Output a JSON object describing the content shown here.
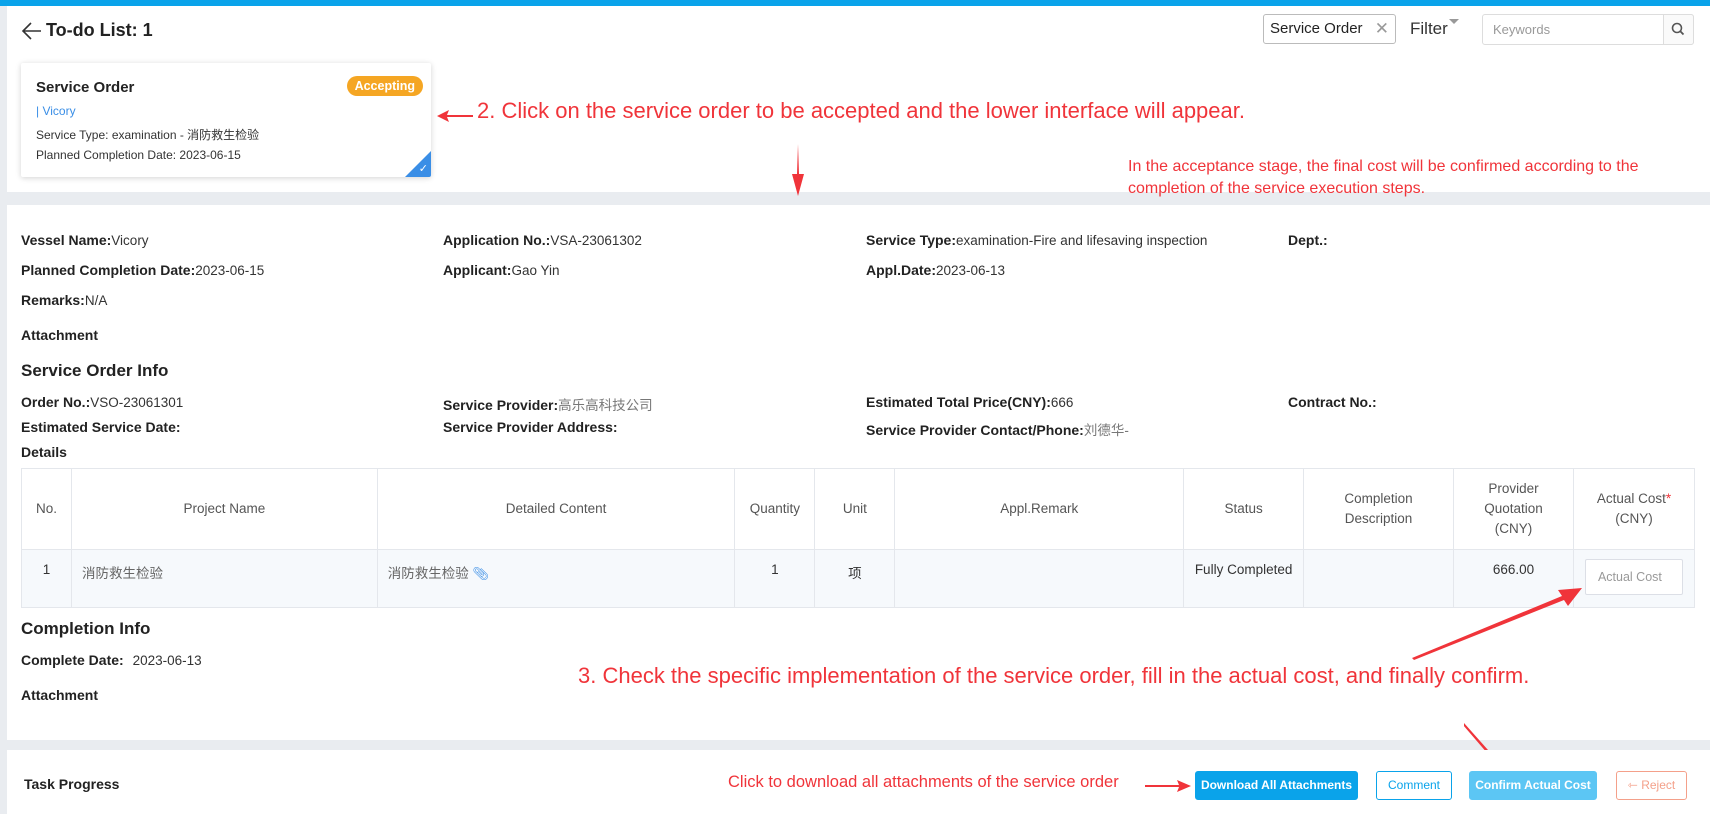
{
  "header": {
    "title": "To-do List: 1",
    "filter_chip": "Service Order",
    "filter_label": "Filter",
    "search_placeholder": "Keywords"
  },
  "card": {
    "title": "Service Order",
    "status_badge": "Accepting",
    "vessel": "| Vicory",
    "service_type": "Service Type:  examination - 消防救生检验",
    "planned_date": "Planned Completion Date:  2023-06-15"
  },
  "annotations": {
    "step2": "2. Click on the service order to be accepted and the lower interface will appear.",
    "cost_note": "In the acceptance stage, the final cost will be confirmed according to the completion of the service execution steps.",
    "step3": "3. Check the specific implementation of the service order, fill in the actual cost, and finally confirm.",
    "download_note": "Click to download all attachments of the service order"
  },
  "application": {
    "vessel_name_label": "Vessel Name:",
    "vessel_name": "Vicory",
    "application_no_label": "Application No.:",
    "application_no": "VSA-23061302",
    "service_type_label": "Service Type:",
    "service_type": "examination-Fire and lifesaving inspection",
    "dept_label": "Dept.:",
    "dept": "",
    "planned_date_label": "Planned Completion Date:",
    "planned_date": "2023-06-15",
    "applicant_label": "Applicant:",
    "applicant": "Gao Yin",
    "appl_date_label": "Appl.Date:",
    "appl_date": "2023-06-13",
    "remarks_label": "Remarks:",
    "remarks": "N/A",
    "attachment_label": "Attachment"
  },
  "service_order_info": {
    "title": "Service Order Info",
    "order_no_label": "Order No.:",
    "order_no": "VSO-23061301",
    "provider_label": "Service Provider:",
    "provider": "高乐高科技公司",
    "est_price_label": "Estimated Total Price(CNY):",
    "est_price": "666",
    "contract_no_label": "Contract No.:",
    "contract_no": "",
    "est_date_label": "Estimated Service Date:",
    "est_date": "",
    "provider_address_label": "Service Provider Address:",
    "provider_address": "",
    "contact_label": "Service Provider Contact/Phone:",
    "contact": "刘德华-",
    "details_label": "Details"
  },
  "details_table": {
    "columns": [
      "No.",
      "Project Name",
      "Detailed Content",
      "Quantity",
      "Unit",
      "Appl.Remark",
      "Status",
      "Completion Description",
      "Provider Quotation (CNY)",
      "Actual Cost",
      "(CNY)"
    ],
    "rows": [
      {
        "no": "1",
        "project_name": "消防救生检验",
        "detailed_content": "消防救生检验",
        "quantity": "1",
        "unit": "项",
        "appl_remark": "",
        "status": "Fully Completed",
        "completion_description": "",
        "provider_quotation": "666.00",
        "actual_cost_value": "",
        "actual_cost_placeholder": "Actual Cost"
      }
    ]
  },
  "completion_info": {
    "title": "Completion Info",
    "complete_date_label": "Complete Date:",
    "complete_date": "2023-06-13",
    "attachment_label": "Attachment"
  },
  "footer": {
    "task_progress": "Task Progress",
    "download_all": "Download All Attachments",
    "comment": "Comment",
    "confirm_actual_cost": "Confirm Actual Cost",
    "reject": "Reject"
  },
  "colors": {
    "primary": "#0aa3ea",
    "accepting_badge": "#f5a623",
    "annotation_red": "#f0343a",
    "link_blue": "#3a8ee6"
  }
}
